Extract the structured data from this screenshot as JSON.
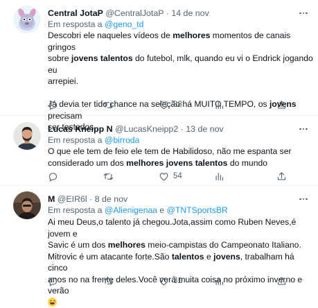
{
  "tweets": [
    {
      "name": "Central JotaP",
      "handle": "@CentralJotaP",
      "date": "· 14 de nov",
      "reply_prefix": "Em resposta a",
      "reply_to": "@geno_td",
      "reply_sep": "",
      "reply_to2": "",
      "lines": [
        [
          {
            "t": "Descobri ele naqueles vídeos de "
          },
          {
            "t": "melhores",
            "b": true
          },
          {
            "t": " momentos de canais gringos"
          }
        ],
        [
          {
            "t": "sobre "
          },
          {
            "t": "jovens talentos",
            "b": true
          },
          {
            "t": " do futebol, mlk, quando eu vi o Endrick jogando eu"
          }
        ],
        [
          {
            "t": "arrepiei."
          }
        ],
        [],
        [
          {
            "t": "Já devia ter tido chance na seleção há MUITO TEMPO, os "
          },
          {
            "t": "jovens",
            "b": true
          },
          {
            "t": " precisam"
          }
        ],
        [
          {
            "t": "ser testados."
          }
        ]
      ],
      "stats": {
        "replies": "",
        "retweets": "",
        "likes": "88"
      }
    },
    {
      "name": "Lucas Kneipp N",
      "handle": "@LucasKneipp2",
      "date": "· 13 de nov",
      "reply_prefix": "Em resposta a",
      "reply_to": "@birroda",
      "reply_sep": "",
      "reply_to2": "",
      "lines": [
        [
          {
            "t": "O que ele tem de feio ele tem de Habilidoso, não me espanta ser"
          }
        ],
        [
          {
            "t": "considerado um dos "
          },
          {
            "t": "melhores jovens talentos",
            "b": true
          },
          {
            "t": " do mundo"
          }
        ]
      ],
      "stats": {
        "replies": "",
        "retweets": "",
        "likes": "54"
      }
    },
    {
      "name": "M",
      "handle": "@EIR6l",
      "date": "· 8 de nov",
      "reply_prefix": "Em resposta a",
      "reply_to": "@Alienigenaa",
      "reply_sep": " e ",
      "reply_to2": "@TNTSportsBR",
      "lines": [
        [
          {
            "t": "Ai meu Deus,o talento já chegou.Jota,assim como Ruben Neves,é jovem e"
          }
        ],
        [
          {
            "t": "Savic é um dos "
          },
          {
            "t": "melhores",
            "b": true
          },
          {
            "t": " meio-campistas do Campeonato Italiano."
          }
        ],
        [
          {
            "t": "Mitrovic é um atacante forte.São "
          },
          {
            "t": "talentos",
            "b": true
          },
          {
            "t": " e "
          },
          {
            "t": "jovens",
            "b": true
          },
          {
            "t": ", trabalham há cinco"
          }
        ],
        [
          {
            "t": "anos no na frente deles.Você verá muita coisa no próximo inverno e verão"
          }
        ],
        [
          {
            "emoji": "joy"
          }
        ]
      ],
      "stats": {
        "replies": "",
        "retweets": "",
        "likes": "31"
      }
    }
  ],
  "icons": {
    "reply": "reply-icon",
    "retweet": "retweet-icon",
    "like": "heart-icon",
    "views": "views-icon",
    "share": "share-icon",
    "more": "more-icon"
  },
  "colors": {
    "link": "#1d9bf0",
    "muted": "#536471",
    "text": "#0f1419",
    "divider": "#eff3f4"
  }
}
